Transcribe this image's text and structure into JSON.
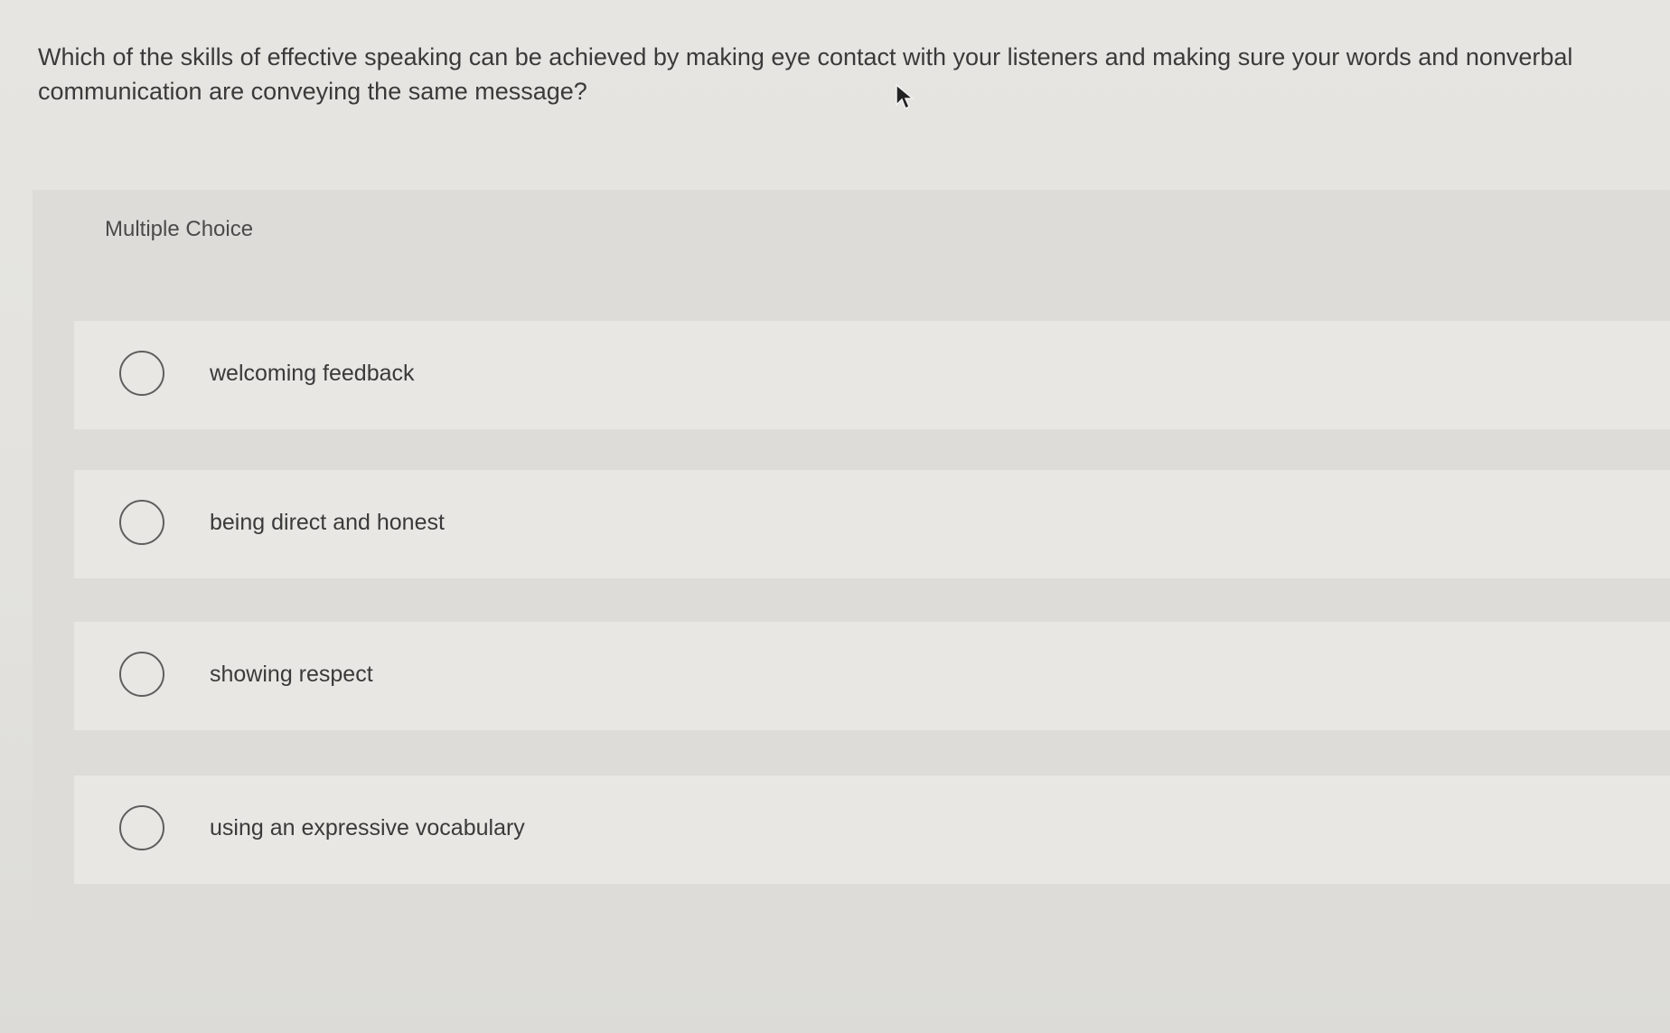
{
  "question": {
    "text": "Which of the skills of effective speaking can be achieved by making eye contact with your listeners and making sure your words and nonverbal communication are conveying the same message?"
  },
  "multiple_choice": {
    "label": "Multiple Choice",
    "options": [
      {
        "label": "welcoming feedback",
        "selected": false
      },
      {
        "label": "being direct and honest",
        "selected": false
      },
      {
        "label": "showing respect",
        "selected": false
      },
      {
        "label": "using an expressive vocabulary",
        "selected": false
      }
    ]
  },
  "icons": {
    "cursor": "mouse-pointer-icon",
    "radio": "radio-circle-icon"
  }
}
